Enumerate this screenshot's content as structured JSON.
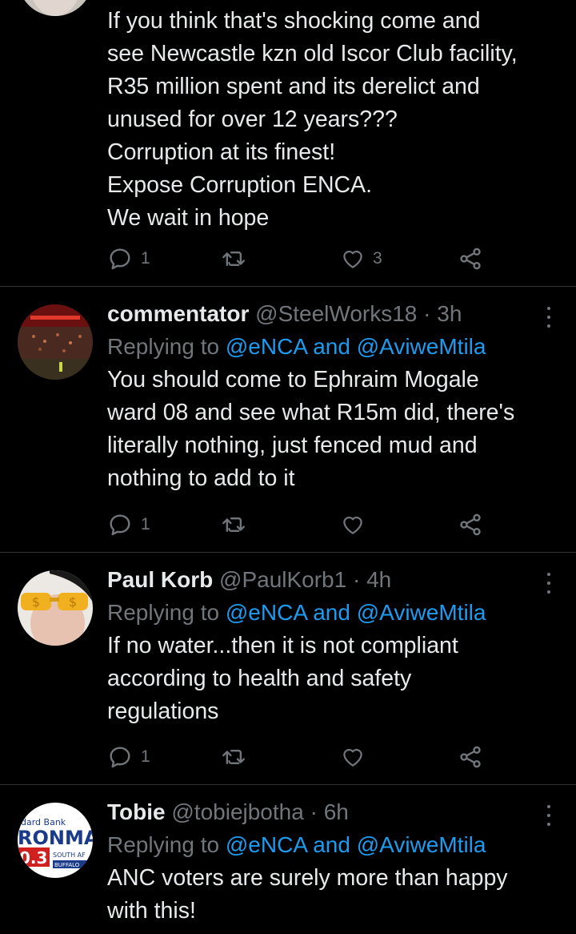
{
  "tweets": [
    {
      "lines": [
        "If you think that's shocking come and",
        "see Newcastle kzn old Iscor Club facility,",
        "R35 million spent and its derelict and",
        "unused for over 12 years???",
        "Corruption at its finest!",
        "Expose Corruption ENCA.",
        "We wait in hope"
      ],
      "reply_count": "1",
      "retweet_count": "",
      "like_count": "3"
    },
    {
      "display_name": "commentator",
      "handle": "@SteelWorks18",
      "time": "· 3h",
      "replying_prefix": "Replying to",
      "mention1": "@eNCA",
      "and_text": "and",
      "mention2": "@AviweMtila",
      "lines": [
        "You should come to Ephraim Mogale",
        "ward 08 and see what R15m did, there's",
        "literally nothing, just fenced mud and",
        "nothing to add to it"
      ],
      "reply_count": "1",
      "retweet_count": "",
      "like_count": ""
    },
    {
      "display_name": "Paul Korb",
      "handle": "@PaulKorb1",
      "time": "· 4h",
      "replying_prefix": "Replying to",
      "mention1": "@eNCA",
      "and_text": "and",
      "mention2": "@AviweMtila",
      "lines": [
        "If no water...then it is not compliant",
        "according to health and safety",
        "regulations"
      ],
      "reply_count": "1",
      "retweet_count": "",
      "like_count": ""
    },
    {
      "display_name": "Tobie",
      "handle": "@tobiejbotha",
      "time": "· 6h",
      "replying_prefix": "Replying to",
      "mention1": "@eNCA",
      "and_text": "and",
      "mention2": "@AviweMtila",
      "lines": [
        "ANC voters are surely more than happy",
        "with this!"
      ],
      "avatar_text": {
        "bank": "dard Bank",
        "brand": "RONMA",
        "number": "0.3",
        "region": "SOUTH AF",
        "city": "BUFFALO"
      }
    }
  ],
  "colors": {
    "background": "#000000",
    "text": "#e7e9ea",
    "muted": "#71767b",
    "link": "#1d9bf0",
    "divider": "#2f3336"
  }
}
